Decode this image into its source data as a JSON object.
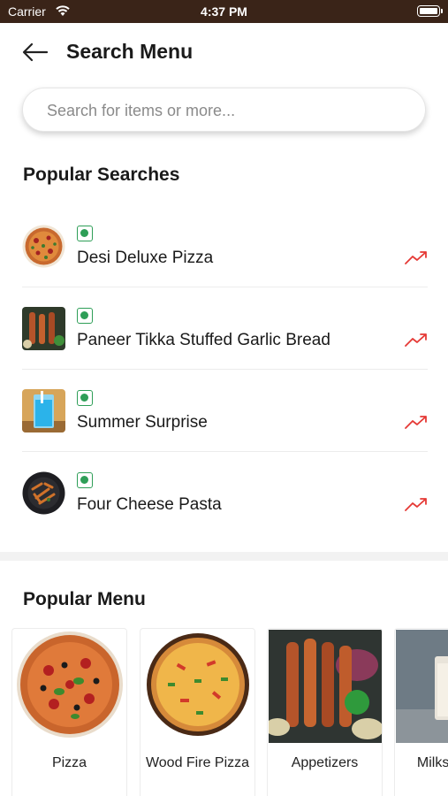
{
  "status_bar": {
    "carrier": "Carrier",
    "time": "4:37 PM"
  },
  "header": {
    "title": "Search Menu"
  },
  "search": {
    "placeholder": "Search for items or more..."
  },
  "popular_searches": {
    "title": "Popular Searches",
    "items": [
      {
        "name": "Desi Deluxe Pizza",
        "icon": "pizza-thumb"
      },
      {
        "name": "Paneer Tikka Stuffed Garlic Bread",
        "icon": "tikka-thumb"
      },
      {
        "name": "Summer Surprise",
        "icon": "drink-thumb"
      },
      {
        "name": "Four Cheese Pasta",
        "icon": "pasta-thumb"
      }
    ]
  },
  "popular_menu": {
    "title": "Popular Menu",
    "items": [
      {
        "label": "Pizza"
      },
      {
        "label": "Wood Fire Pizza"
      },
      {
        "label": "Appetizers"
      },
      {
        "label": "Milkshakes"
      }
    ]
  },
  "colors": {
    "veg": "#2e9e57",
    "trend": "#e53935",
    "status_bar": "#3a2418"
  }
}
